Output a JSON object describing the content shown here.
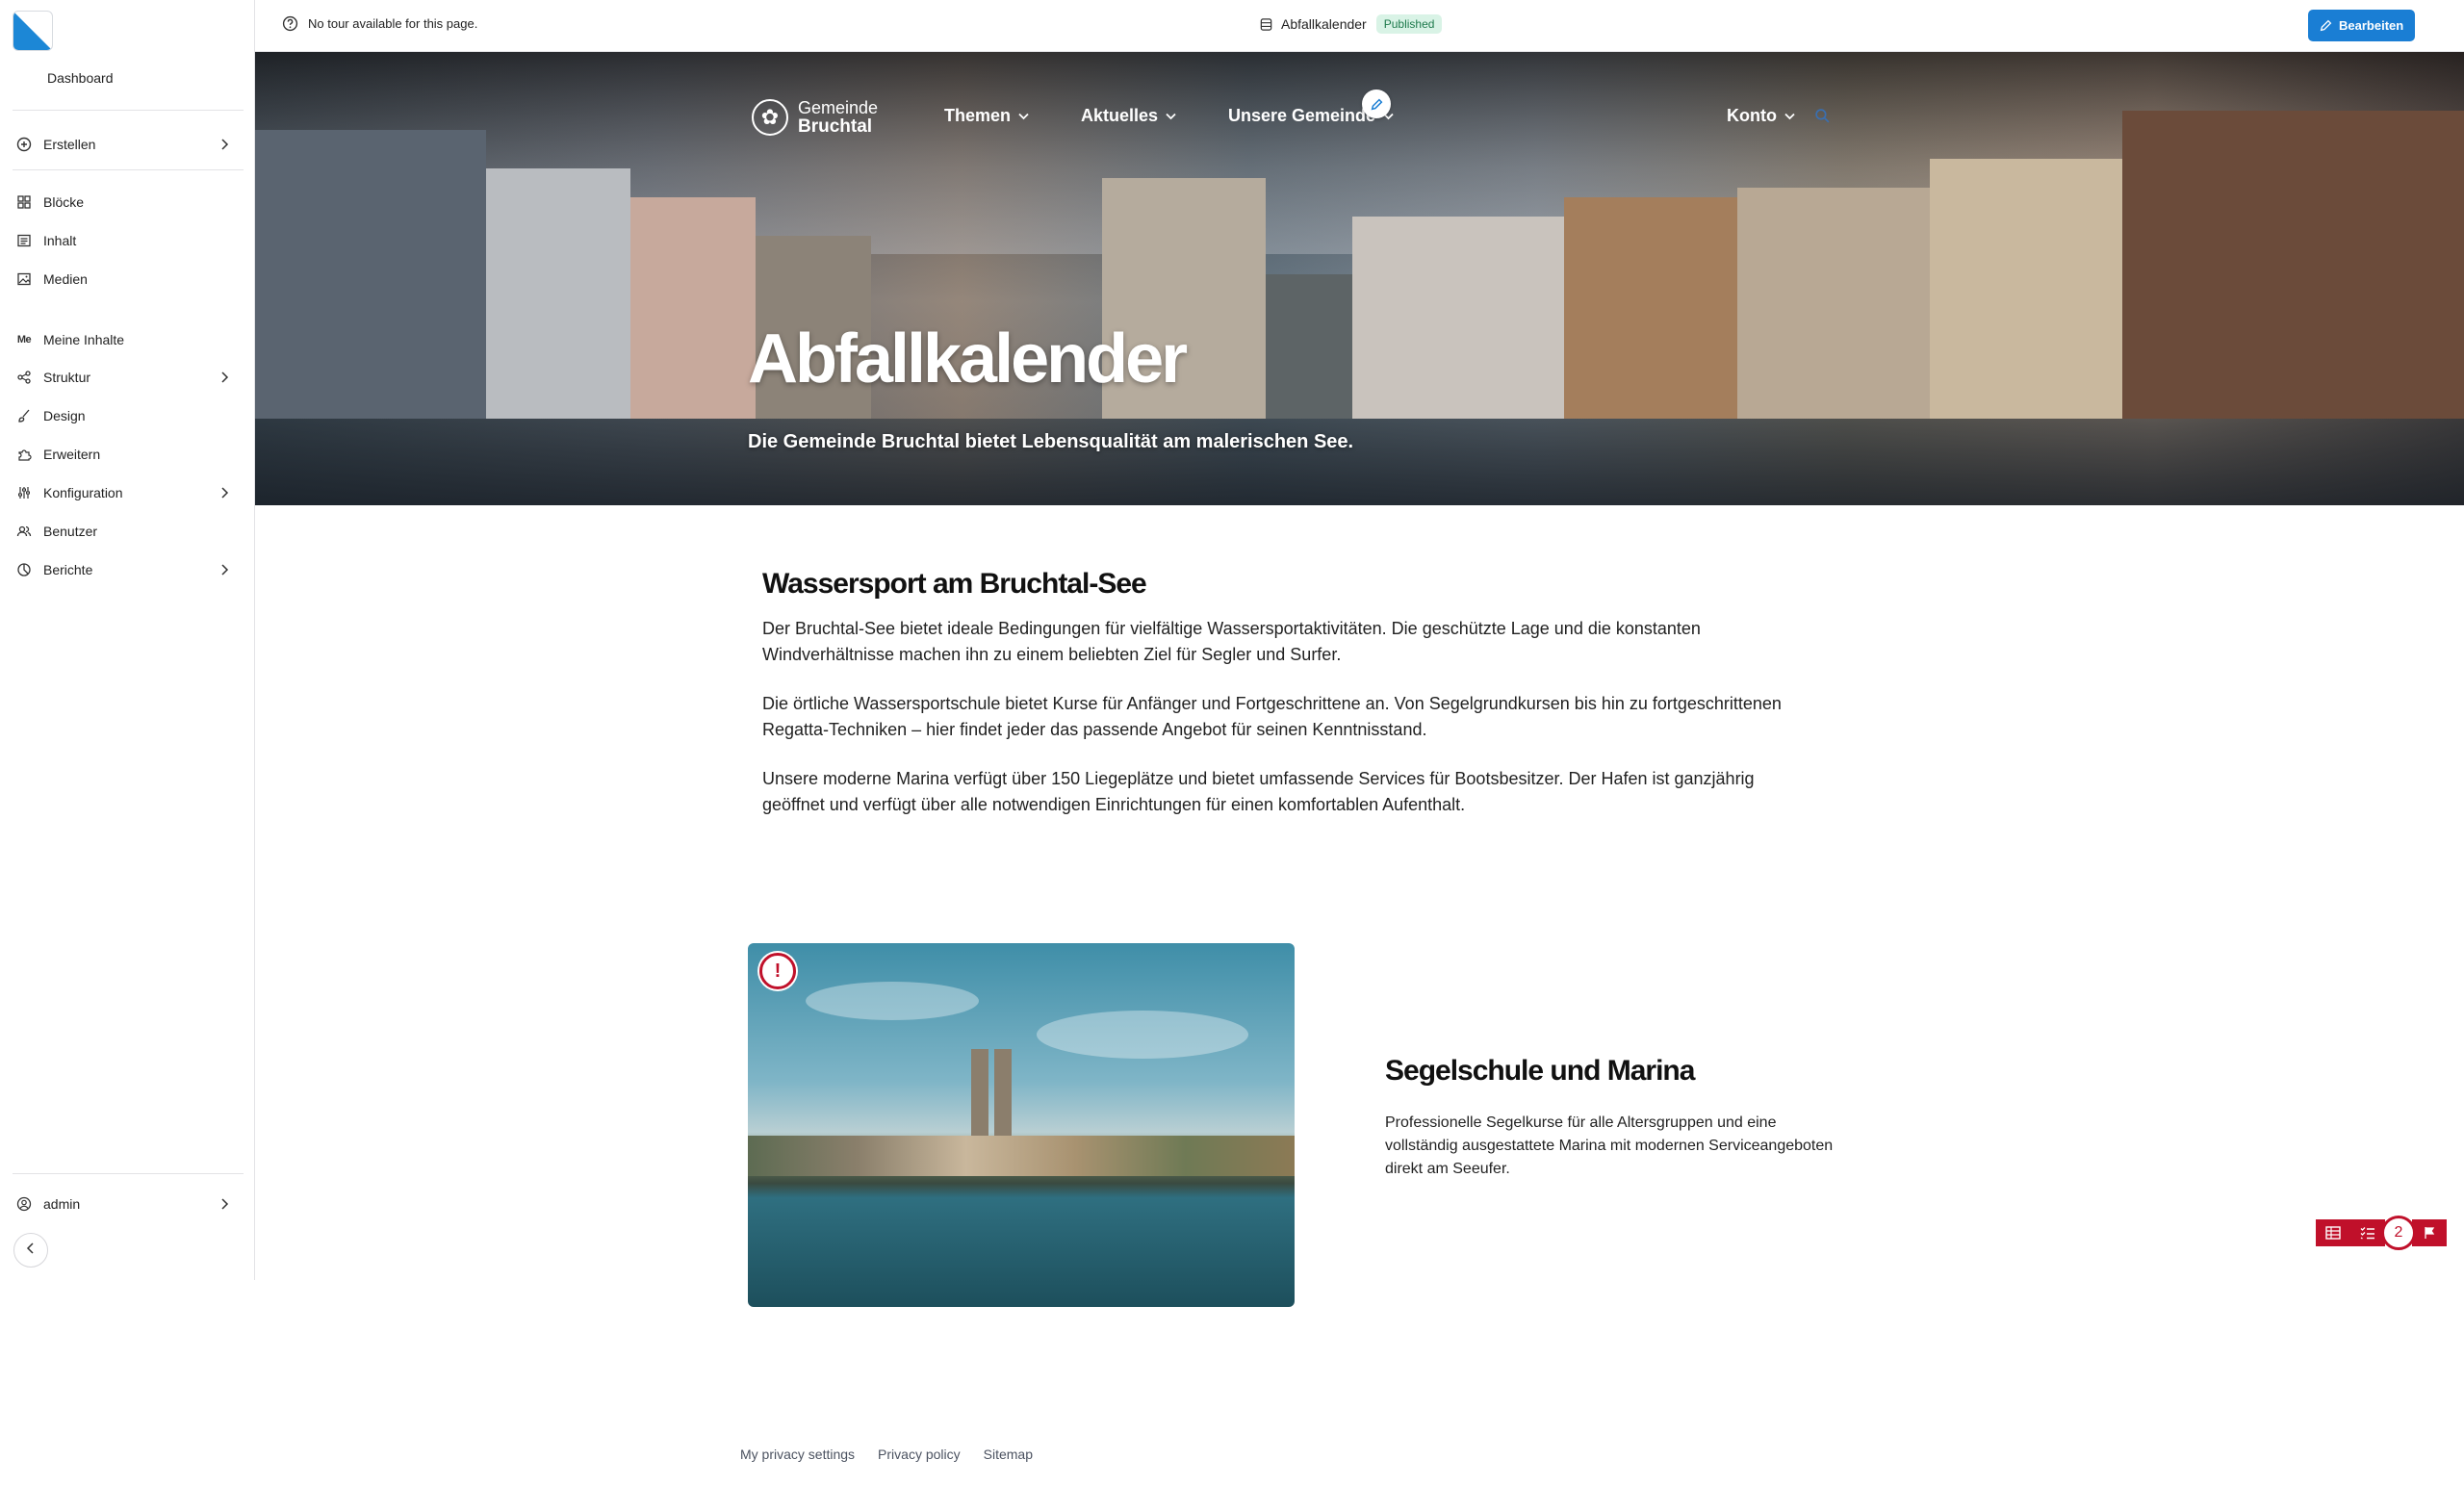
{
  "sidebar": {
    "dashboard": "Dashboard",
    "items": [
      {
        "label": "Erstellen",
        "icon": "plus-circle-icon"
      },
      {
        "label": "Blöcke",
        "icon": "blocks-icon"
      },
      {
        "label": "Inhalt",
        "icon": "content-icon"
      },
      {
        "label": "Medien",
        "icon": "media-icon"
      },
      {
        "label": "Meine Inhalte",
        "icon": "me-icon",
        "icon_text": "Me"
      },
      {
        "label": "Struktur",
        "icon": "structure-icon"
      },
      {
        "label": "Design",
        "icon": "brush-icon"
      },
      {
        "label": "Erweitern",
        "icon": "puzzle-icon"
      },
      {
        "label": "Konfiguration",
        "icon": "sliders-icon"
      },
      {
        "label": "Benutzer",
        "icon": "users-icon"
      },
      {
        "label": "Berichte",
        "icon": "reports-icon"
      }
    ],
    "user": "admin"
  },
  "topbar": {
    "tour_text": "No tour available for this page.",
    "page_title": "Abfallkalender",
    "status": "Published",
    "edit_label": "Bearbeiten"
  },
  "site": {
    "brand_line1": "Gemeinde",
    "brand_line2": "Bruchtal",
    "nav": [
      "Themen",
      "Aktuelles",
      "Unsere Gemeinde",
      "Konto"
    ]
  },
  "hero": {
    "title": "Abfallkalender",
    "subtitle": "Die Gemeinde Bruchtal bietet Lebensqualität am malerischen See."
  },
  "content": {
    "title": "Wassersport am Bruchtal-See",
    "paragraphs": [
      "Der Bruchtal-See bietet ideale Bedingungen für vielfältige Wassersportaktivitäten. Die geschützte Lage und die konstanten Windverhältnisse machen ihn zu einem beliebten Ziel für Segler und Surfer.",
      "Die örtliche Wassersportschule bietet Kurse für Anfänger und Fortgeschrittene an. Von Segelgrundkursen bis hin zu fortgeschrittenen Regatta-Techniken – hier findet jeder das passende Angebot für seinen Kenntnisstand.",
      "Unsere moderne Marina verfügt über 150 Liegeplätze und bietet umfassende Services für Bootsbesitzer. Der Hafen ist ganzjährig geöffnet und verfügt über alle notwendigen Einrichtungen für einen komfortablen Aufenthalt."
    ]
  },
  "card": {
    "title": "Segelschule und Marina",
    "text": "Professionelle Segelkurse für alle Altersgruppen und eine vollständig ausgestattete Marina mit modernen Serviceangeboten direkt am Seeufer.",
    "warning": "!"
  },
  "tools": {
    "issue_count": "2"
  },
  "footer": {
    "links": [
      "My privacy settings",
      "Privacy policy",
      "Sitemap"
    ]
  },
  "colors": {
    "accent": "#1a7ed4",
    "published_bg": "#d9f3e6",
    "alert": "#c0102a"
  }
}
